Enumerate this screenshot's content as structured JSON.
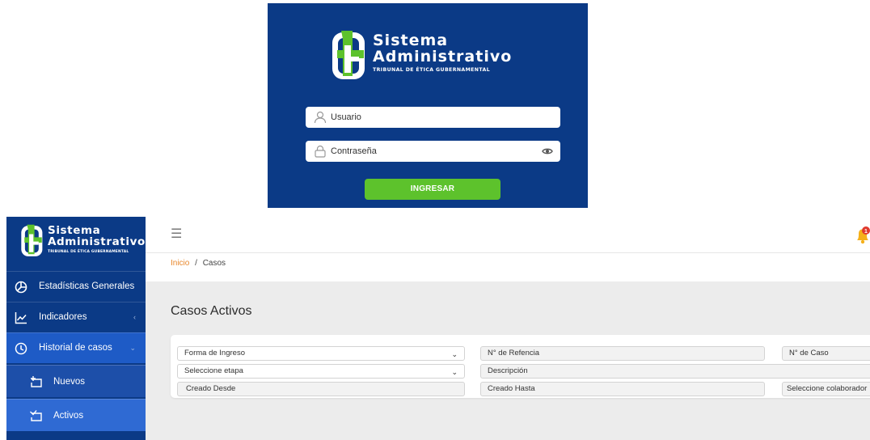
{
  "login": {
    "brand_line1": "Sistema",
    "brand_line2": "Administrativo",
    "brand_tagline": "TRIBUNAL DE ÉTICA GUBERNAMENTAL",
    "username_placeholder": "Usuario",
    "password_placeholder": "Contraseña",
    "submit_label": "INGRESAR"
  },
  "sidebar": {
    "brand_line1": "Sistema",
    "brand_line2": "Administrativo",
    "brand_tagline": "TRIBUNAL DE ÉTICA GUBERNAMENTAL",
    "items": [
      {
        "label": "Estadísticas Generales",
        "icon": "pie-chart-icon"
      },
      {
        "label": "Indicadores",
        "icon": "line-chart-icon",
        "chevron": "‹"
      },
      {
        "label": "Historial de casos",
        "icon": "clock-icon",
        "chevron": "⌄"
      }
    ],
    "subitems": [
      {
        "label": "Nuevos",
        "icon": "new-case-icon"
      },
      {
        "label": "Activos",
        "icon": "active-case-icon"
      }
    ]
  },
  "header": {
    "menu_icon": "hamburger-icon",
    "notification_count": "1"
  },
  "breadcrumb": {
    "home": "Inicio",
    "separator": "/",
    "current": "Casos"
  },
  "main": {
    "title": "Casos Activos",
    "filters": {
      "forma_ingreso": "Forma de Ingreso",
      "num_referencia": "N° de Refencia",
      "num_caso": "N° de Caso",
      "etapa": "Seleccione etapa",
      "descripcion": "Descripción",
      "creado_desde": "Creado Desde",
      "creado_hasta": "Creado Hasta",
      "colaborador": "Seleccione colaborador"
    }
  },
  "colors": {
    "brand_blue": "#0b3a86",
    "accent_green": "#5dc22c",
    "active_blue": "#2f6ad3",
    "breadcrumb_orange": "#e8872b",
    "notification_orange": "#f5b01a",
    "badge_red": "#e03a2e"
  }
}
